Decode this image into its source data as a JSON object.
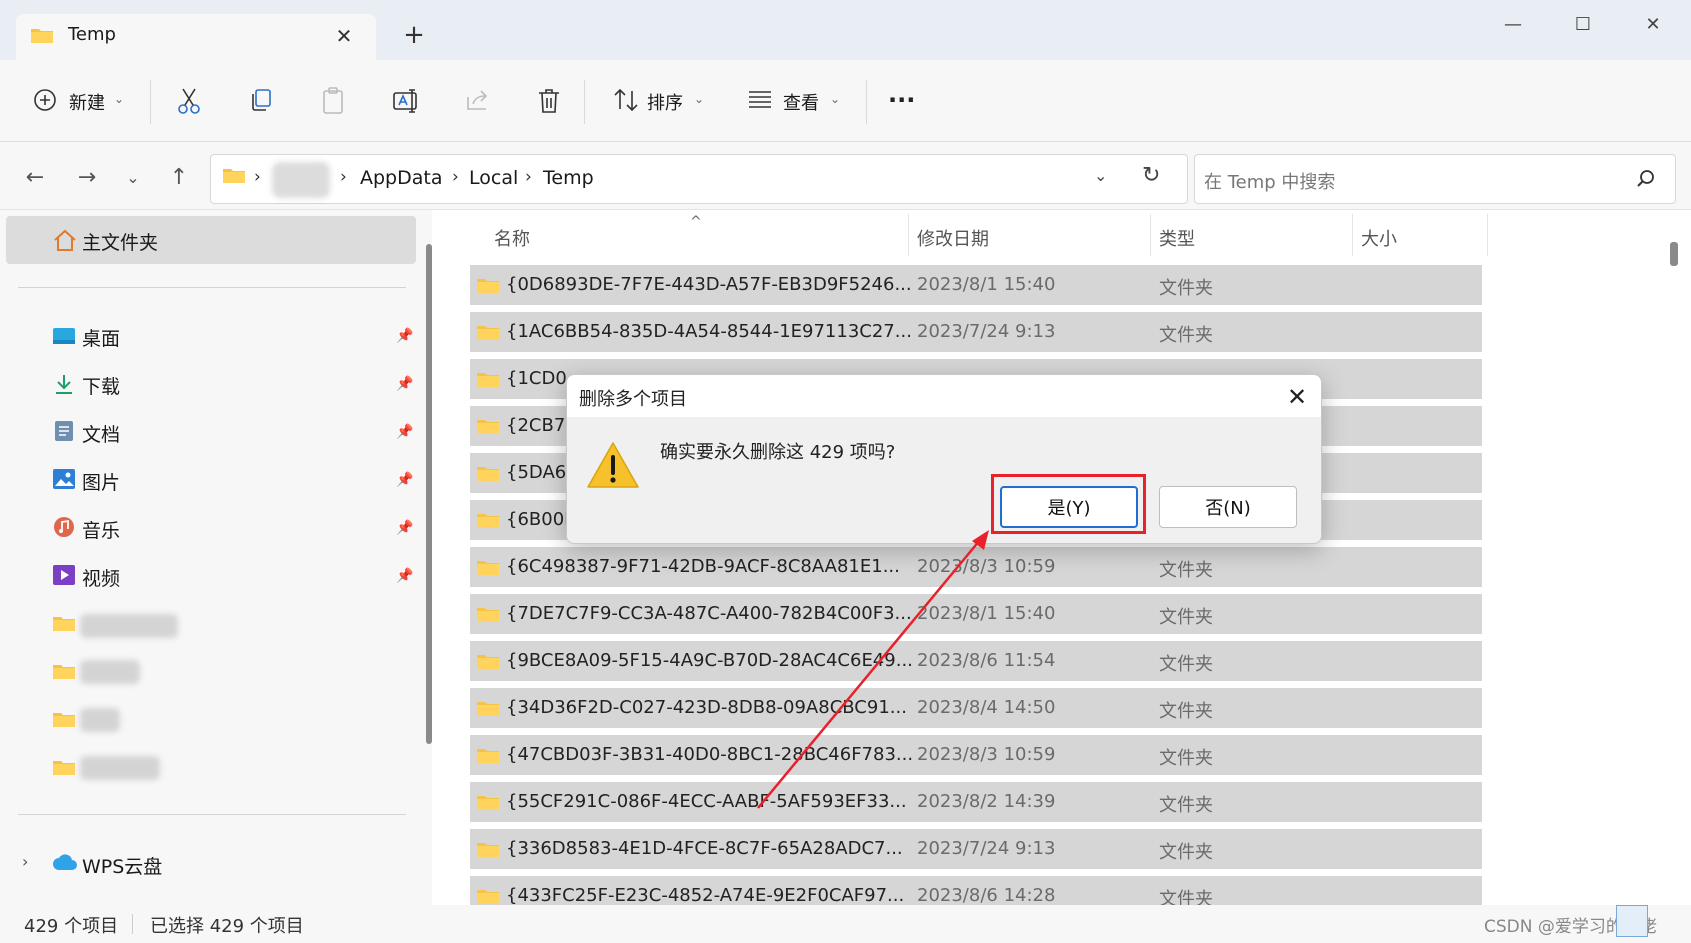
{
  "window": {
    "tab_title": "Temp",
    "tab_close": "✕",
    "new_tab": "+",
    "controls": {
      "minimize": "—",
      "maximize": "☐",
      "close": "✕"
    }
  },
  "toolbar": {
    "new_label": "新建",
    "sort_label": "排序",
    "view_label": "查看",
    "more": "···"
  },
  "address": {
    "crumbs": [
      "AppData",
      "Local",
      "Temp"
    ],
    "search_placeholder": "在 Temp 中搜索"
  },
  "sidebar": {
    "home": "主文件夹",
    "pinned": [
      {
        "label": "桌面",
        "icon": "desktop-icon"
      },
      {
        "label": "下载",
        "icon": "download-icon"
      },
      {
        "label": "文档",
        "icon": "documents-icon"
      },
      {
        "label": "图片",
        "icon": "pictures-icon"
      },
      {
        "label": "音乐",
        "icon": "music-icon"
      },
      {
        "label": "视频",
        "icon": "videos-icon"
      }
    ],
    "cloud": "WPS云盘"
  },
  "list": {
    "columns": [
      "名称",
      "修改日期",
      "类型",
      "大小"
    ],
    "rows": [
      {
        "name": "{0D6893DE-7F7E-443D-A57F-EB3D9F5246...",
        "date": "2023/8/1 15:40",
        "type": "文件夹"
      },
      {
        "name": "{1AC6BB54-835D-4A54-8544-1E97113C27...",
        "date": "2023/7/24 9:13",
        "type": "文件夹"
      },
      {
        "name": "{1CD0",
        "date": "",
        "type": ""
      },
      {
        "name": "{2CB7F",
        "date": "",
        "type": ""
      },
      {
        "name": "{5DA67",
        "date": "",
        "type": ""
      },
      {
        "name": "{6B00D",
        "date": "",
        "type": ""
      },
      {
        "name": "{6C498387-9F71-42DB-9ACF-8C8AA81E1...",
        "date": "2023/8/3 10:59",
        "type": "文件夹"
      },
      {
        "name": "{7DE7C7F9-CC3A-487C-A400-782B4C00F3...",
        "date": "2023/8/1 15:40",
        "type": "文件夹"
      },
      {
        "name": "{9BCE8A09-5F15-4A9C-B70D-28AC4C6E49...",
        "date": "2023/8/6 11:54",
        "type": "文件夹"
      },
      {
        "name": "{34D36F2D-C027-423D-8DB8-09A8CBC91...",
        "date": "2023/8/4 14:50",
        "type": "文件夹"
      },
      {
        "name": "{47CBD03F-3B31-40D0-8BC1-28BC46F783...",
        "date": "2023/8/3 10:59",
        "type": "文件夹"
      },
      {
        "name": "{55CF291C-086F-4ECC-AABF-5AF593EF33...",
        "date": "2023/8/2 14:39",
        "type": "文件夹"
      },
      {
        "name": "{336D8583-4E1D-4FCE-8C7F-65A28ADC7...",
        "date": "2023/7/24 9:13",
        "type": "文件夹"
      },
      {
        "name": "{433FC25F-E23C-4852-A74E-9E2F0CAF97...",
        "date": "2023/8/6 14:28",
        "type": "文件夹"
      }
    ]
  },
  "status": {
    "count": "429 个项目",
    "selected": "已选择 429 个项目",
    "watermark": "CSDN @爱学习的鱼佬"
  },
  "dialog": {
    "title": "删除多个项目",
    "message": "确实要永久删除这 429 项吗?",
    "yes": "是(Y)",
    "no": "否(N)"
  },
  "colors": {
    "accent": "#1f6fd0",
    "annotation": "#e8212b",
    "folder": "#f6c445",
    "selected_row": "#d6d6d6"
  }
}
